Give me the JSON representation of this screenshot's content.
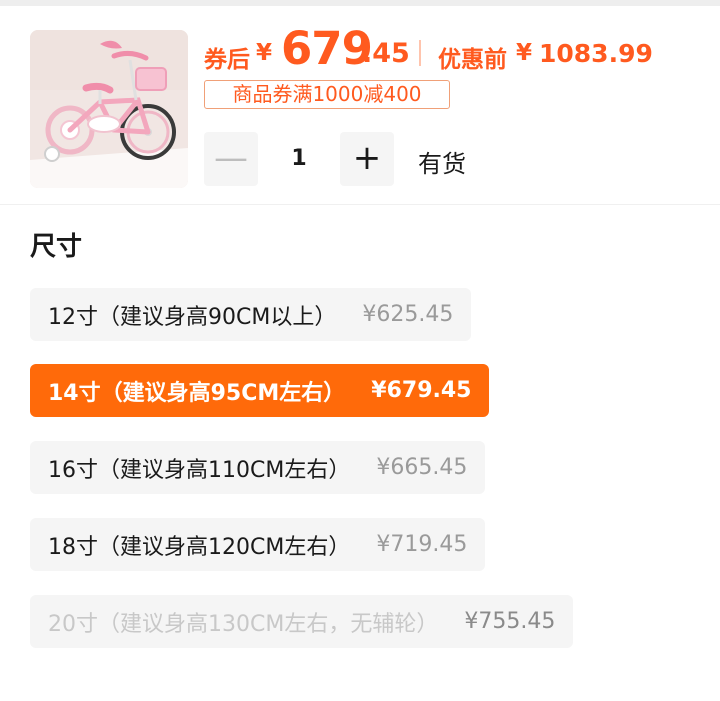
{
  "product": {
    "image_alt": "pink children's bicycle",
    "price_after_label": "券后",
    "currency": "¥",
    "price_after_int": "679",
    "price_after_dec": ".45",
    "price_before_label": "优惠前",
    "price_before": "1083.99",
    "coupon_text": "商品券满1000减400"
  },
  "quantity": {
    "minus": "—",
    "value": "1",
    "plus": "+",
    "stock_status": "有货"
  },
  "size_section": {
    "title": "尺寸",
    "options": [
      {
        "label": "12寸（建议身高90CM以上）",
        "price": "¥625.45",
        "state": "normal"
      },
      {
        "label": "14寸（建议身高95CM左右）",
        "price": "¥679.45",
        "state": "selected"
      },
      {
        "label": "16寸（建议身高110CM左右）",
        "price": "¥665.45",
        "state": "normal"
      },
      {
        "label": "18寸（建议身高120CM左右）",
        "price": "¥719.45",
        "state": "normal"
      },
      {
        "label": "20寸（建议身高130CM左右，无辅轮）",
        "price": "¥755.45",
        "state": "disabled"
      }
    ]
  },
  "colors": {
    "accent": "#ff5a1f",
    "selected_bg": "#ff6a0a",
    "option_bg": "#f5f5f5"
  }
}
